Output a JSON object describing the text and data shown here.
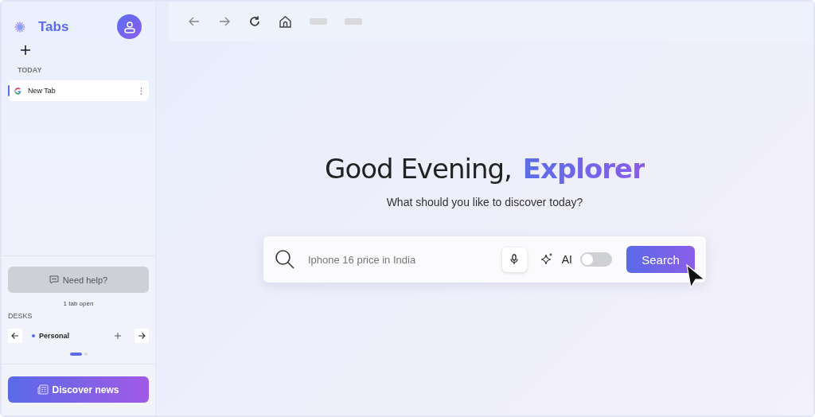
{
  "sidebar": {
    "title": "Tabs",
    "section": "TODAY",
    "tabs": [
      {
        "label": "New Tab",
        "selected": true
      }
    ],
    "help_button": "Need help?",
    "tab_count": "1 tab open",
    "desks_label": "DESKS",
    "desk": {
      "name": "Personal",
      "color": "#5b6cf0"
    },
    "desk_pages": [
      {
        "selected": true
      },
      {
        "selected": false
      }
    ],
    "discover_button": "Discover news"
  },
  "greeting": {
    "text": "Good Evening,",
    "name": "Explorer"
  },
  "subtitle": "What should you like to discover today?",
  "search": {
    "placeholder": "Iphone 16 price in India",
    "ai_label": "AI",
    "ai_on": false,
    "button": "Search"
  }
}
